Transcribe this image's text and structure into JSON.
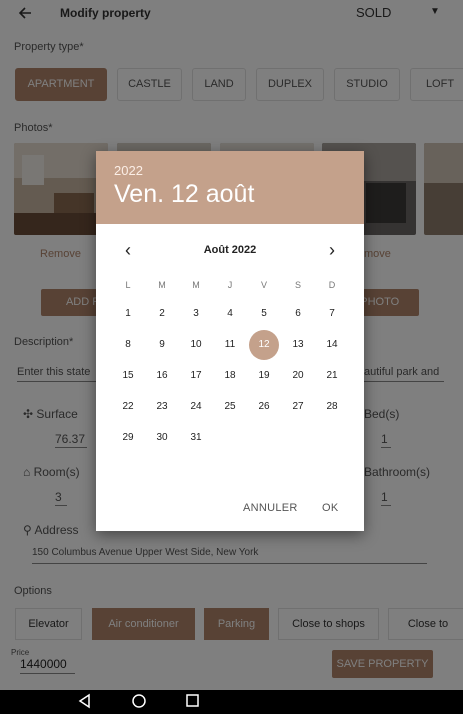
{
  "appbar": {
    "title": "Modify property",
    "status": "SOLD"
  },
  "property_type": {
    "label": "Property type*",
    "chips": [
      {
        "label": "APARTMENT",
        "selected": true
      },
      {
        "label": "CASTLE",
        "selected": false
      },
      {
        "label": "LAND",
        "selected": false
      },
      {
        "label": "DUPLEX",
        "selected": false
      },
      {
        "label": "STUDIO",
        "selected": false
      },
      {
        "label": "LOFT",
        "selected": false
      }
    ]
  },
  "photos": {
    "label": "Photos*",
    "remove_label": "Remove",
    "remove_label_partial": "move",
    "add_photo_partial": "ADD PHO",
    "take_photo_partial": "E PHOTO"
  },
  "description": {
    "label": "Description*",
    "value_left": "Enter this state",
    "value_right": "autiful park and"
  },
  "surface": {
    "label": "Surface",
    "value": "76.37"
  },
  "beds": {
    "label": "Bed(s)",
    "value": "1"
  },
  "rooms": {
    "label": "Room(s)",
    "value": "3"
  },
  "bathrooms": {
    "label": "Bathroom(s)",
    "value": "1"
  },
  "address": {
    "label": "Address",
    "value": "150 Columbus Avenue Upper West Side, New York"
  },
  "options": {
    "label": "Options",
    "items": [
      {
        "label": "Elevator",
        "selected": false
      },
      {
        "label": "Air conditioner",
        "selected": true
      },
      {
        "label": "Parking",
        "selected": true
      },
      {
        "label": "Close to shops",
        "selected": false
      },
      {
        "label": "Close to",
        "selected": false
      }
    ]
  },
  "price": {
    "label": "Price",
    "value": "1440000"
  },
  "save_button": "SAVE PROPERTY",
  "datepicker": {
    "year": "2022",
    "date_title": "Ven. 12 août",
    "month_label": "Août 2022",
    "weekdays": [
      "L",
      "M",
      "M",
      "J",
      "V",
      "S",
      "D"
    ],
    "selected_day": 12,
    "cancel": "ANNULER",
    "ok": "OK"
  },
  "colors": {
    "accent": "#b0856a",
    "header": "#c4a18b"
  }
}
